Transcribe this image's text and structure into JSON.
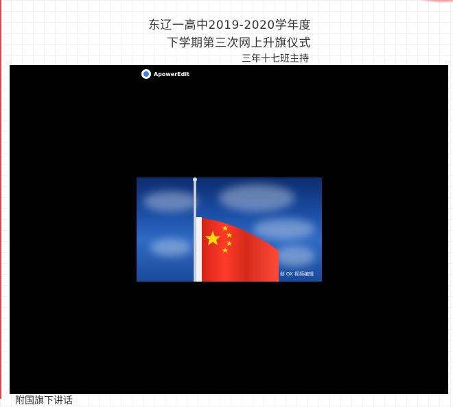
{
  "article": {
    "title_line1": "东辽一高中2019-2020学年度",
    "title_line2": "下学期第三次网上升旗仪式",
    "host": "三年十七班主持",
    "caption": "附国旗下讲话"
  },
  "video": {
    "watermark": "ApowerEdit",
    "brand_mark": "创 OX 视频编辑"
  },
  "colors": {
    "accent": "#d94a4a",
    "video_background": "#000000",
    "flag_red": "#e62d1f",
    "flag_star": "#ffde00"
  }
}
